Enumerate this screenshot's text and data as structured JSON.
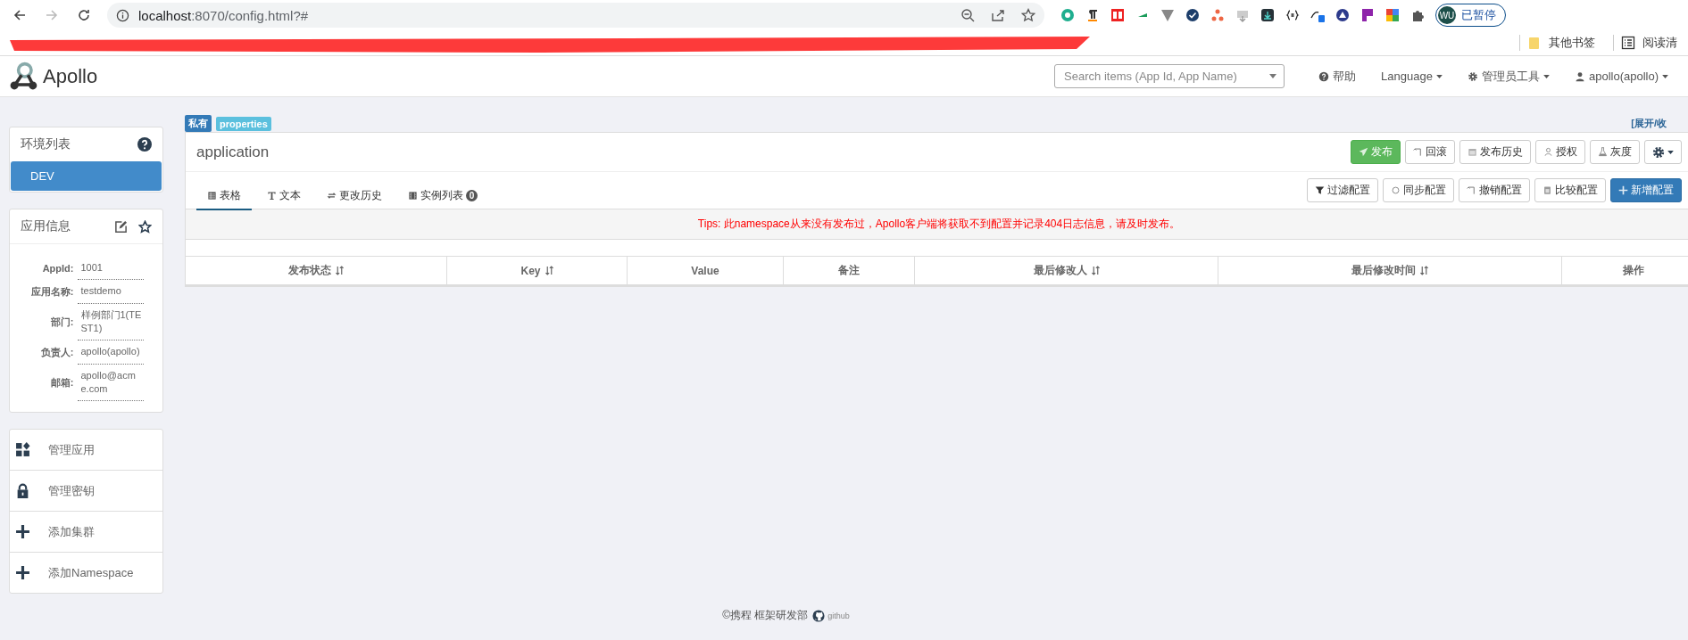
{
  "browser": {
    "back": {
      "disabled": false
    },
    "forward": {
      "disabled": true
    },
    "url": {
      "host": "localhost",
      "path": ":8070/config.html?#"
    },
    "profile": {
      "initials": "WU",
      "label": "已暂停"
    },
    "bookmarks": [
      "其他书签",
      "阅读清"
    ]
  },
  "navbar": {
    "brand": "Apollo",
    "search": {
      "placeholder": "Search items (App Id, App Name)"
    },
    "links": [
      {
        "kind": "help",
        "label": "帮助",
        "dropdown": false
      },
      {
        "kind": "plain",
        "label": "Language",
        "dropdown": true
      },
      {
        "kind": "gear",
        "label": "管理员工具",
        "dropdown": true
      },
      {
        "kind": "user",
        "label": "apollo(apollo)",
        "dropdown": true
      }
    ]
  },
  "sidebar": {
    "environments": {
      "title": "环境列表",
      "items": [
        {
          "label": "DEV",
          "selected": true
        }
      ]
    },
    "app_info": {
      "title": "应用信息",
      "fields": [
        {
          "label": "AppId:",
          "value": "1001"
        },
        {
          "label": "应用名称:",
          "value": "testdemo"
        },
        {
          "label": "部门:",
          "value": "样例部门1(TEST1)"
        },
        {
          "label": "负责人:",
          "value": "apollo(apollo)"
        },
        {
          "label": "邮箱:",
          "value": "apollo@acme.com"
        }
      ]
    },
    "actions": [
      {
        "kind": "apps",
        "label": "管理应用"
      },
      {
        "kind": "lock",
        "label": "管理密钥"
      },
      {
        "kind": "plus",
        "label": "添加集群"
      },
      {
        "kind": "plus",
        "label": "添加Namespace"
      }
    ]
  },
  "namespace": {
    "tags": [
      {
        "kind": "scope",
        "label": "私有"
      },
      {
        "kind": "format",
        "label": "properties"
      }
    ],
    "toggle": "[展开/收",
    "name": "application",
    "header_buttons": [
      {
        "kind": "send",
        "label": "发布"
      },
      {
        "kind": "rollback",
        "label": "回滚"
      },
      {
        "kind": "calendar",
        "label": "发布历史"
      },
      {
        "kind": "user",
        "label": "授权"
      },
      {
        "kind": "flask",
        "label": "灰度"
      }
    ],
    "tabs": [
      {
        "kind": "table",
        "label": "表格",
        "selected": true
      },
      {
        "kind": "text",
        "label": "文本",
        "selected": false
      },
      {
        "kind": "history",
        "label": "更改历史",
        "selected": false
      },
      {
        "kind": "list",
        "label": "实例列表",
        "selected": false,
        "badge": "0"
      }
    ],
    "tool_buttons": [
      {
        "kind": "filter",
        "label": "过滤配置"
      },
      {
        "kind": "sync",
        "label": "同步配置"
      },
      {
        "kind": "rollback",
        "label": "撤销配置"
      },
      {
        "kind": "compare",
        "label": "比较配置"
      },
      {
        "kind": "plus",
        "label": "新增配置"
      }
    ],
    "tips": "Tips: 此namespace从来没有发布过，Apollo客户端将获取不到配置并记录404日志信息，请及时发布。",
    "table": {
      "columns": [
        {
          "label": "发布状态",
          "sortable": true
        },
        {
          "label": "Key",
          "sortable": true
        },
        {
          "label": "Value",
          "sortable": false
        },
        {
          "label": "备注",
          "sortable": false
        },
        {
          "label": "最后修改人",
          "sortable": true
        },
        {
          "label": "最后修改时间",
          "sortable": true
        },
        {
          "label": "操作",
          "sortable": false
        }
      ]
    }
  },
  "footer": {
    "copyright": "©携程 框架研发部",
    "link": "github"
  }
}
